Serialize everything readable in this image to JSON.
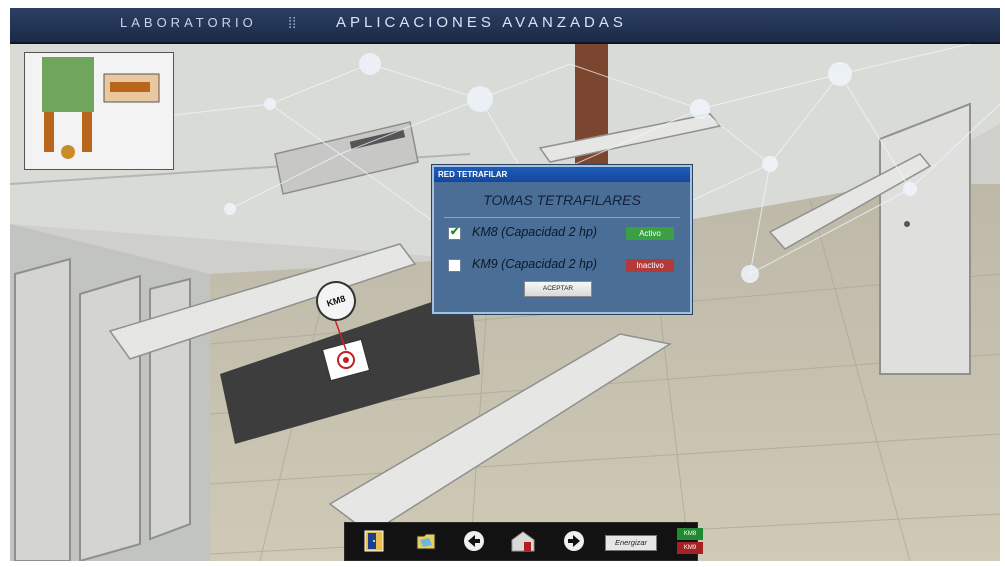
{
  "header": {
    "section": "LABORATORIO",
    "title": "APLICACIONES AVANZADAS"
  },
  "scene": {
    "tag_label": "KM8"
  },
  "dialog": {
    "title": "RED TETRAFILAR",
    "heading": "TOMAS TETRAFILARES",
    "items": [
      {
        "label": "KM8 (Capacidad 2 hp)",
        "checked": true,
        "status": "Activo",
        "status_color": "#3aa043"
      },
      {
        "label": "KM9 (Capacidad 2 hp)",
        "checked": false,
        "status": "Inactivo",
        "status_color": "#b33a3a"
      }
    ],
    "accept_label": "ACEPTAR"
  },
  "toolbar": {
    "icons": [
      "door-exit-icon",
      "folder-diagram-icon",
      "arrow-left-icon",
      "home-icon",
      "arrow-right-icon"
    ],
    "energize_label": "Energizar",
    "indicators": [
      {
        "label": "KM8",
        "color": "#1f8a30"
      },
      {
        "label": "KM9",
        "color": "#a62222"
      }
    ]
  },
  "colors": {
    "title_bar": "#1b2a47",
    "dialog_bg": "#4a6e95",
    "dialog_title": "#1446a0"
  }
}
